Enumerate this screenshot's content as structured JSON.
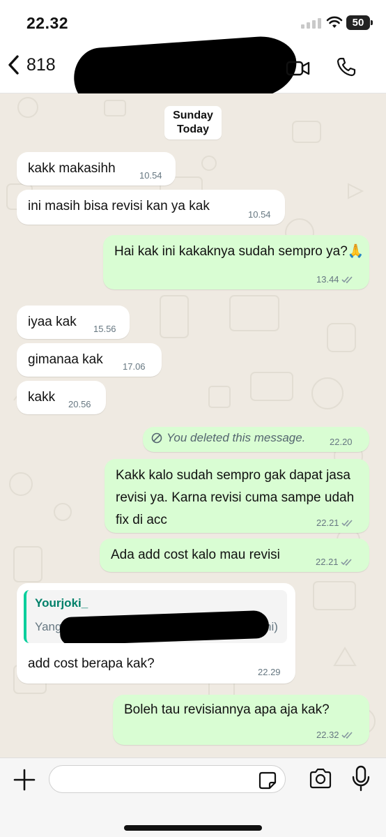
{
  "status_bar": {
    "time": "22.32",
    "battery": "50"
  },
  "header": {
    "back_count": "818"
  },
  "date_chip": {
    "line1": "Sunday",
    "line2": "Today"
  },
  "messages": [
    {
      "text": "kakk makasihh",
      "time": "10.54"
    },
    {
      "text": "ini masih bisa revisi kan ya kak",
      "time": "10.54"
    },
    {
      "text": "Hai kak ini kakaknya sudah sempro ya?🙏",
      "time": "13.44"
    },
    {
      "text": "iyaa kak",
      "time": "15.56"
    },
    {
      "text": "gimanaa kak",
      "time": "17.06"
    },
    {
      "text": "kakk",
      "time": "20.56"
    },
    {
      "text": "You deleted this message.",
      "time": "22.20"
    },
    {
      "text": "Kakk kalo sudah sempro gak dapat jasa revisi ya. Karna revisi cuma sampe udah fix di acc",
      "time": "22.21"
    },
    {
      "text": "Ada add cost kalo mau revisi",
      "time": "22.21"
    },
    {
      "quote_author": "Yourjoki_",
      "quote_start": "Yang",
      "quote_end": "ni)",
      "text": "add cost berapa kak?",
      "time": "22.29"
    },
    {
      "text": "Boleh tau revisiannya apa aja kak?",
      "time": "22.32"
    }
  ],
  "input": {
    "placeholder": ""
  },
  "colors": {
    "incoming": "#ffffff",
    "outgoing": "#d9fdd3",
    "chat_background": "#efeae2",
    "read_ticks": "#8696a0",
    "quote_accent": "#06cf9c",
    "quote_author": "#008069"
  },
  "icons": [
    "back-chevron-icon",
    "video-call-icon",
    "phone-icon",
    "plus-icon",
    "sticker-icon",
    "camera-icon",
    "mic-icon",
    "wifi-icon",
    "signal-icon",
    "double-check-icon",
    "deleted-icon"
  ]
}
